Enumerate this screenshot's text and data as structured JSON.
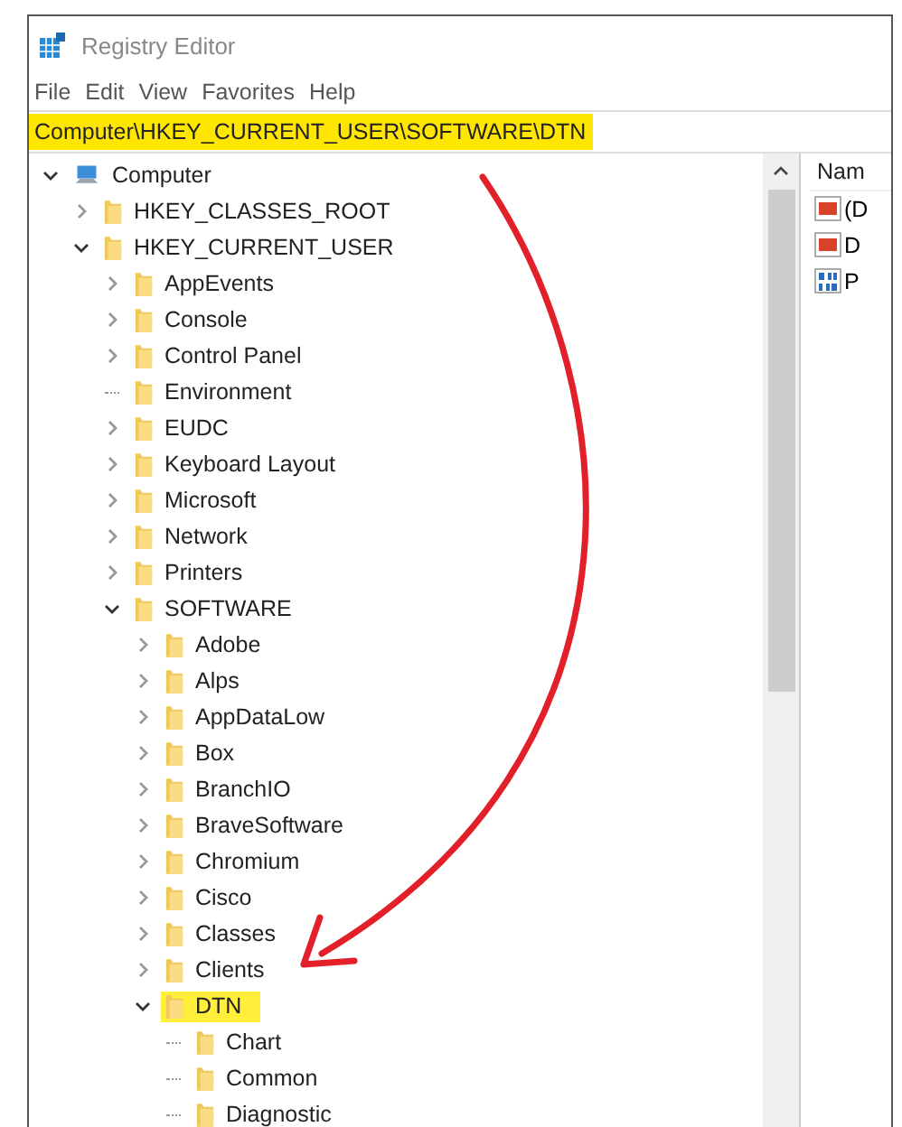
{
  "window": {
    "title": "Registry Editor"
  },
  "menu": [
    "File",
    "Edit",
    "View",
    "Favorites",
    "Help"
  ],
  "address": {
    "value": "Computer\\HKEY_CURRENT_USER\\SOFTWARE\\DTN",
    "highlighted": true
  },
  "tree": [
    {
      "label": "Computer",
      "kind": "computer",
      "has_children": true,
      "expanded": true,
      "highlighted": false,
      "children": [
        {
          "label": "HKEY_CLASSES_ROOT",
          "kind": "folder",
          "has_children": true,
          "expanded": false,
          "highlighted": false
        },
        {
          "label": "HKEY_CURRENT_USER",
          "kind": "folder",
          "has_children": true,
          "expanded": true,
          "highlighted": false,
          "children": [
            {
              "label": "AppEvents",
              "kind": "folder",
              "has_children": true,
              "expanded": false,
              "highlighted": false
            },
            {
              "label": "Console",
              "kind": "folder",
              "has_children": true,
              "expanded": false,
              "highlighted": false
            },
            {
              "label": "Control Panel",
              "kind": "folder",
              "has_children": true,
              "expanded": false,
              "highlighted": false
            },
            {
              "label": "Environment",
              "kind": "folder",
              "has_children": false,
              "highlighted": false
            },
            {
              "label": "EUDC",
              "kind": "folder",
              "has_children": true,
              "expanded": false,
              "highlighted": false
            },
            {
              "label": "Keyboard Layout",
              "kind": "folder",
              "has_children": true,
              "expanded": false,
              "highlighted": false
            },
            {
              "label": "Microsoft",
              "kind": "folder",
              "has_children": true,
              "expanded": false,
              "highlighted": false
            },
            {
              "label": "Network",
              "kind": "folder",
              "has_children": true,
              "expanded": false,
              "highlighted": false
            },
            {
              "label": "Printers",
              "kind": "folder",
              "has_children": true,
              "expanded": false,
              "highlighted": false
            },
            {
              "label": "SOFTWARE",
              "kind": "folder",
              "has_children": true,
              "expanded": true,
              "highlighted": false,
              "children": [
                {
                  "label": "Adobe",
                  "kind": "folder",
                  "has_children": true,
                  "expanded": false,
                  "highlighted": false
                },
                {
                  "label": "Alps",
                  "kind": "folder",
                  "has_children": true,
                  "expanded": false,
                  "highlighted": false
                },
                {
                  "label": "AppDataLow",
                  "kind": "folder",
                  "has_children": true,
                  "expanded": false,
                  "highlighted": false
                },
                {
                  "label": "Box",
                  "kind": "folder",
                  "has_children": true,
                  "expanded": false,
                  "highlighted": false
                },
                {
                  "label": "BranchIO",
                  "kind": "folder",
                  "has_children": true,
                  "expanded": false,
                  "highlighted": false
                },
                {
                  "label": "BraveSoftware",
                  "kind": "folder",
                  "has_children": true,
                  "expanded": false,
                  "highlighted": false
                },
                {
                  "label": "Chromium",
                  "kind": "folder",
                  "has_children": true,
                  "expanded": false,
                  "highlighted": false
                },
                {
                  "label": "Cisco",
                  "kind": "folder",
                  "has_children": true,
                  "expanded": false,
                  "highlighted": false
                },
                {
                  "label": "Classes",
                  "kind": "folder",
                  "has_children": true,
                  "expanded": false,
                  "highlighted": false
                },
                {
                  "label": "Clients",
                  "kind": "folder",
                  "has_children": true,
                  "expanded": false,
                  "highlighted": false
                },
                {
                  "label": "DTN",
                  "kind": "folder",
                  "has_children": true,
                  "expanded": true,
                  "highlighted": true,
                  "children": [
                    {
                      "label": "Chart",
                      "kind": "folder",
                      "has_children": false,
                      "highlighted": false
                    },
                    {
                      "label": "Common",
                      "kind": "folder",
                      "has_children": false,
                      "highlighted": false
                    },
                    {
                      "label": "Diagnostic",
                      "kind": "folder",
                      "has_children": false,
                      "highlighted": false
                    }
                  ]
                }
              ]
            }
          ]
        }
      ]
    }
  ],
  "values": {
    "header": "Nam",
    "rows": [
      {
        "name": "(D",
        "kind": "string"
      },
      {
        "name": "D",
        "kind": "string"
      },
      {
        "name": "P",
        "kind": "binary"
      }
    ]
  },
  "annotation": {
    "kind": "arrow"
  }
}
